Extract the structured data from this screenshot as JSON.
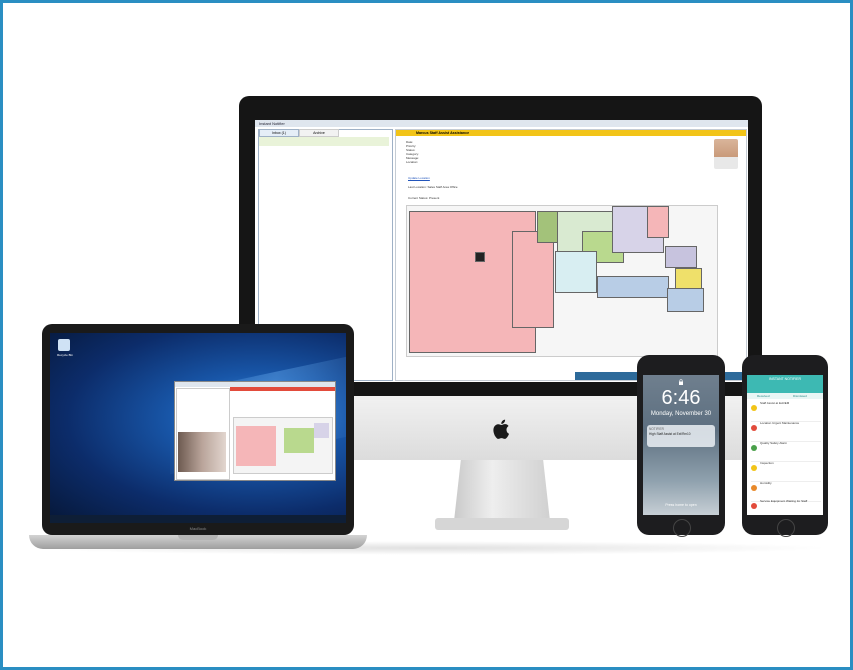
{
  "desktop_app": {
    "title": "Instant Notifier",
    "tab_inbox": "Inbox (1)",
    "tab_archive": "Archive",
    "alert_title": "Marcus Staff Assist Assistance",
    "info_lines": [
      "Date:",
      "Priority:",
      "Status:",
      "Category:",
      "Message:",
      "Location:"
    ],
    "link_text": "Update Location",
    "location_label": "Last Location: Sales Staff Area Office",
    "current_status": "Current Status: Present"
  },
  "laptop": {
    "desktop_icon_label": "Recycle Bin",
    "brand_label": "MacBook"
  },
  "phone_lock": {
    "time": "6:46",
    "date": "Monday, November 30",
    "notif_app": "NOTIFIER",
    "notif_text": "High Staff Assist at Ext/Rm10",
    "slide_text": "Press home to open"
  },
  "phone_app": {
    "header": "INSTANT NOTIFIER",
    "tab1": "Received",
    "tab2": "Dismissed",
    "items": [
      {
        "title": "Staff Assist at Exit/EM",
        "color": "#f2c418"
      },
      {
        "title": "Location Urgent Maintenance",
        "color": "#e24b3b"
      },
      {
        "title": "Quality Safety Alarm",
        "color": "#4aa04a"
      },
      {
        "title": "Inspection",
        "color": "#f2c418"
      },
      {
        "title": "Humidity",
        "color": "#e8892b"
      },
      {
        "title": "Service Equipment Waiting for Staff",
        "color": "#e24b3b"
      }
    ]
  }
}
